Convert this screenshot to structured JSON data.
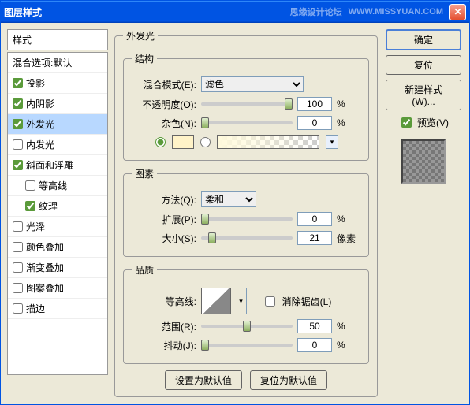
{
  "title": "图层样式",
  "watermark1": "思缘设计论坛",
  "watermark2": "WWW.MISSYUAN.COM",
  "sidebar": {
    "header": "样式",
    "blend_options": "混合选项:默认",
    "items": [
      {
        "label": "投影",
        "checked": true,
        "selected": false
      },
      {
        "label": "内阴影",
        "checked": true,
        "selected": false
      },
      {
        "label": "外发光",
        "checked": true,
        "selected": true
      },
      {
        "label": "内发光",
        "checked": false,
        "selected": false
      },
      {
        "label": "斜面和浮雕",
        "checked": true,
        "selected": false
      },
      {
        "label": "等高线",
        "checked": false,
        "selected": false,
        "indent": true
      },
      {
        "label": "纹理",
        "checked": true,
        "selected": false,
        "indent": true
      },
      {
        "label": "光泽",
        "checked": false,
        "selected": false
      },
      {
        "label": "颜色叠加",
        "checked": false,
        "selected": false
      },
      {
        "label": "渐变叠加",
        "checked": false,
        "selected": false
      },
      {
        "label": "图案叠加",
        "checked": false,
        "selected": false
      },
      {
        "label": "描边",
        "checked": false,
        "selected": false
      }
    ]
  },
  "main": {
    "title": "外发光",
    "structure": {
      "legend": "结构",
      "blend_mode_label": "混合模式(E):",
      "blend_mode_value": "滤色",
      "opacity_label": "不透明度(O):",
      "opacity_value": "100",
      "noise_label": "杂色(N):",
      "noise_value": "0",
      "pct": "%",
      "swatch_color": "#fff3c8"
    },
    "elements": {
      "legend": "图素",
      "technique_label": "方法(Q):",
      "technique_value": "柔和",
      "spread_label": "扩展(P):",
      "spread_value": "0",
      "size_label": "大小(S):",
      "size_value": "21",
      "pct": "%",
      "px": "像素"
    },
    "quality": {
      "legend": "品质",
      "contour_label": "等高线:",
      "antialias_label": "消除锯齿(L)",
      "range_label": "范围(R):",
      "range_value": "50",
      "jitter_label": "抖动(J):",
      "jitter_value": "0",
      "pct": "%"
    },
    "buttons": {
      "default": "设置为默认值",
      "reset": "复位为默认值"
    }
  },
  "right": {
    "ok": "确定",
    "cancel": "复位",
    "new_style": "新建样式(W)...",
    "preview": "预览(V)"
  }
}
